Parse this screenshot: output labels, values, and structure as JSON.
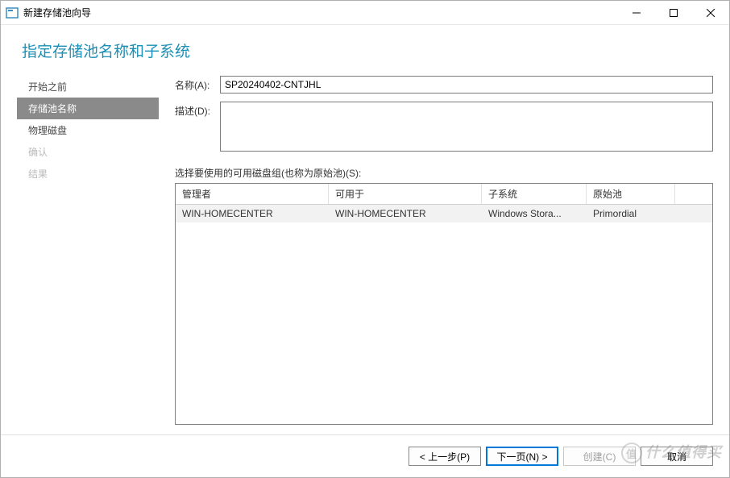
{
  "window": {
    "title": "新建存储池向导"
  },
  "page": {
    "heading": "指定存储池名称和子系统"
  },
  "sidebar": {
    "steps": [
      {
        "label": "开始之前",
        "state": "done"
      },
      {
        "label": "存储池名称",
        "state": "active"
      },
      {
        "label": "物理磁盘",
        "state": "done"
      },
      {
        "label": "确认",
        "state": "future"
      },
      {
        "label": "结果",
        "state": "future"
      }
    ]
  },
  "form": {
    "name_label": "名称(A):",
    "name_value": "SP20240402-CNTJHL",
    "desc_label": "描述(D):",
    "desc_value": ""
  },
  "grid_section": {
    "label": "选择要使用的可用磁盘组(也称为原始池)(S):",
    "columns": [
      "管理者",
      "可用于",
      "子系统",
      "原始池",
      ""
    ],
    "rows": [
      {
        "cells": [
          "WIN-HOMECENTER",
          "WIN-HOMECENTER",
          "Windows Stora...",
          "Primordial",
          ""
        ],
        "selected": true
      }
    ]
  },
  "footer": {
    "prev": "< 上一步(P)",
    "next": "下一页(N) >",
    "create": "创建(C)",
    "cancel": "取消"
  },
  "watermark": "什么值得买"
}
